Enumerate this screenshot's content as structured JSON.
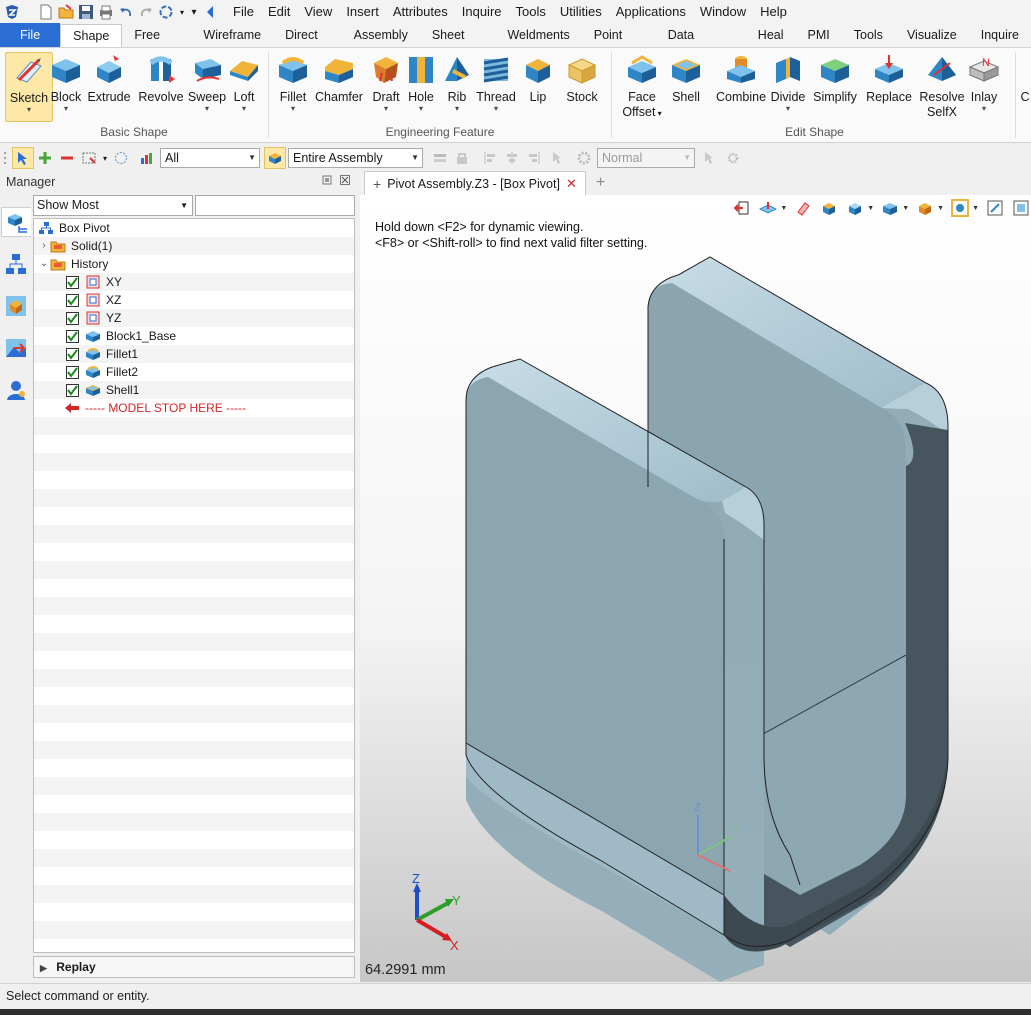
{
  "menubar": {
    "items": [
      "File",
      "Edit",
      "View",
      "Insert",
      "Attributes",
      "Inquire",
      "Tools",
      "Utilities",
      "Applications",
      "Window",
      "Help"
    ]
  },
  "ribbon": {
    "tabs": [
      "File",
      "Shape",
      "Free Form",
      "Wireframe",
      "Direct Edit",
      "Assembly",
      "Sheet Metal",
      "Weldments",
      "Point Cloud",
      "Data Exchange",
      "Heal",
      "PMI",
      "Tools",
      "Visualize",
      "Inquire"
    ],
    "active_tab": "Shape",
    "groups": {
      "basic_shape": "Basic Shape",
      "engineering_feature": "Engineering Feature",
      "edit_shape": "Edit Shape"
    },
    "buttons": {
      "sketch": "Sketch",
      "block": "Block",
      "extrude": "Extrude",
      "revolve": "Revolve",
      "sweep": "Sweep",
      "loft": "Loft",
      "fillet": "Fillet",
      "chamfer": "Chamfer",
      "draft": "Draft",
      "hole": "Hole",
      "rib": "Rib",
      "thread": "Thread",
      "lip": "Lip",
      "stock": "Stock",
      "face_offset_1": "Face",
      "face_offset_2": "Offset",
      "shell": "Shell",
      "combine": "Combine",
      "divide": "Divide",
      "simplify": "Simplify",
      "replace": "Replace",
      "resolve_1": "Resolve",
      "resolve_2": "SelfX",
      "inlay": "Inlay",
      "cut": "C"
    }
  },
  "filterbar": {
    "filter_value": "All",
    "scope_value": "Entire Assembly",
    "mode_value": "Normal"
  },
  "manager": {
    "title": "Manager",
    "show_value": "Show Most",
    "search_value": "",
    "tree": {
      "root": "Box Pivot",
      "solid": "Solid(1)",
      "history": "History",
      "items": [
        "XY",
        "XZ",
        "YZ",
        "Block1_Base",
        "Fillet1",
        "Fillet2",
        "Shell1"
      ],
      "stop": "----- MODEL STOP HERE -----"
    },
    "replay": "Replay"
  },
  "document": {
    "tab_title": "Pivot Assembly.Z3 - [Box Pivot]"
  },
  "viewport": {
    "hint_line1": "Hold down <F2> for dynamic viewing.",
    "hint_line2": "<F8> or <Shift-roll> to find next valid filter setting.",
    "measurement": "64.2991 mm",
    "axis_x": "X",
    "axis_y": "Y",
    "axis_z": "Z"
  },
  "status": {
    "text": "Select command or entity."
  },
  "colors": {
    "accent": "#2a6ed4",
    "part_face": "#8fa8b3",
    "part_top": "#b7cfda",
    "part_inner": "#47565e",
    "stop_red": "#d1262a"
  }
}
